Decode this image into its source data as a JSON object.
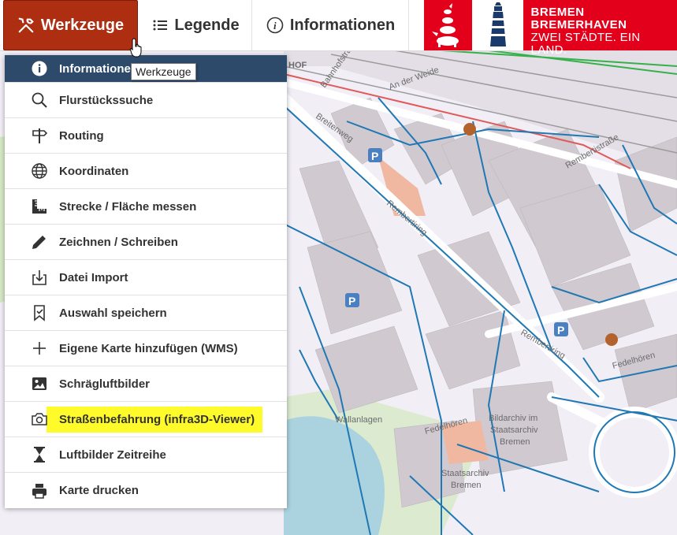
{
  "toolbar": {
    "tools_label": "Werkzeuge",
    "legend_label": "Legende",
    "info_label": "Informationen"
  },
  "logo": {
    "line1": "BREMEN",
    "line2": "BREMERHAVEN",
    "line3": "ZWEI STÄDTE. EIN LAND."
  },
  "tooltip": "Werkzeuge",
  "menu": {
    "items": [
      {
        "label": "Informationen",
        "icon": "info-icon",
        "active": true
      },
      {
        "label": "Flurstückssuche",
        "icon": "search-icon"
      },
      {
        "label": "Routing",
        "icon": "signpost-icon"
      },
      {
        "label": "Koordinaten",
        "icon": "globe-icon"
      },
      {
        "label": "Strecke / Fläche messen",
        "icon": "ruler-icon"
      },
      {
        "label": "Zeichnen / Schreiben",
        "icon": "pencil-icon"
      },
      {
        "label": "Datei Import",
        "icon": "file-import-icon"
      },
      {
        "label": "Auswahl speichern",
        "icon": "bookmark-check-icon"
      },
      {
        "label": "Eigene Karte hinzufügen (WMS)",
        "icon": "plus-icon"
      },
      {
        "label": "Schrägluftbilder",
        "icon": "image-icon"
      },
      {
        "label": "Straßenbefahrung (infra3D-Viewer)",
        "icon": "camera-icon",
        "highlighted": true
      },
      {
        "label": "Luftbilder Zeitreihe",
        "icon": "hourglass-icon"
      },
      {
        "label": "Karte drucken",
        "icon": "printer-icon"
      }
    ]
  },
  "map": {
    "labels": {
      "bahnhofstr": "Bahnhofstraße",
      "anderweide": "An der Weide",
      "breitenweg": "Breitenweg",
      "rembertiring": "Rembertiring",
      "rembertiring2": "Rembertiring",
      "rembertistr": "Rembertistraße",
      "wallanlagen": "Wallanlagen",
      "bildarchiv1": "Bildarchiv im",
      "bildarchiv2": "Staatsarchiv",
      "bildarchiv3": "Bremen",
      "staatsarchiv1": "Staatsarchiv",
      "staatsarchiv2": "Bremen",
      "feldstr": "Fedelhören",
      "feldstr2": "Fedelhören",
      "hof": "HOF"
    }
  },
  "colors": {
    "tools_bg": "#ae2e12",
    "active_item_bg": "#2e4a6b",
    "highlight": "#fffb2a",
    "logo_red": "#e3001b",
    "water_lines": "#1f78b4"
  }
}
